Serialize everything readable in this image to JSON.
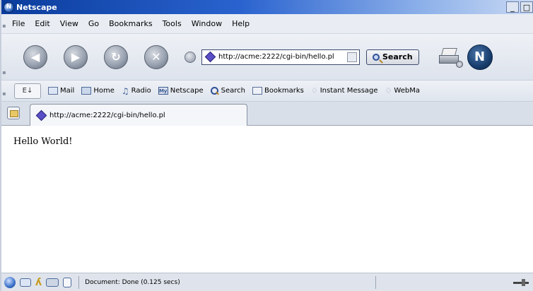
{
  "window": {
    "title": "Netscape",
    "app_icon": "netscape-logo",
    "controls": [
      "_",
      "□"
    ]
  },
  "menubar": {
    "items": [
      {
        "label": "File",
        "icon": ""
      },
      {
        "label": "Edit"
      },
      {
        "label": "View"
      },
      {
        "label": "Go"
      },
      {
        "label": "Bookmarks"
      },
      {
        "label": "Tools"
      },
      {
        "label": "Window"
      },
      {
        "label": "Help"
      }
    ]
  },
  "navbar": {
    "back_icon": "back-arrow-icon",
    "forward_icon": "forward-arrow-icon",
    "reload_icon": "reload-icon",
    "stop_icon": "stop-icon",
    "url": "http://acme:2222/cgi-bin/hello.pl",
    "search_label": "Search",
    "throbber_label": "N"
  },
  "personalbar": {
    "tabs_label": "E↓",
    "items": [
      {
        "label": "Mail"
      },
      {
        "label": "Home"
      },
      {
        "label": "Radio"
      },
      {
        "label": "Netscape"
      },
      {
        "label": "Search"
      },
      {
        "label": "Bookmarks"
      },
      {
        "label": "Instant Message"
      },
      {
        "label": "WebMa"
      }
    ]
  },
  "tabstrip": {
    "active_tab_label": "http://acme:2222/cgi-bin/hello.pl"
  },
  "content": {
    "text": "Hello World!"
  },
  "statusbar": {
    "status": "Document: Done (0.125 secs)"
  }
}
